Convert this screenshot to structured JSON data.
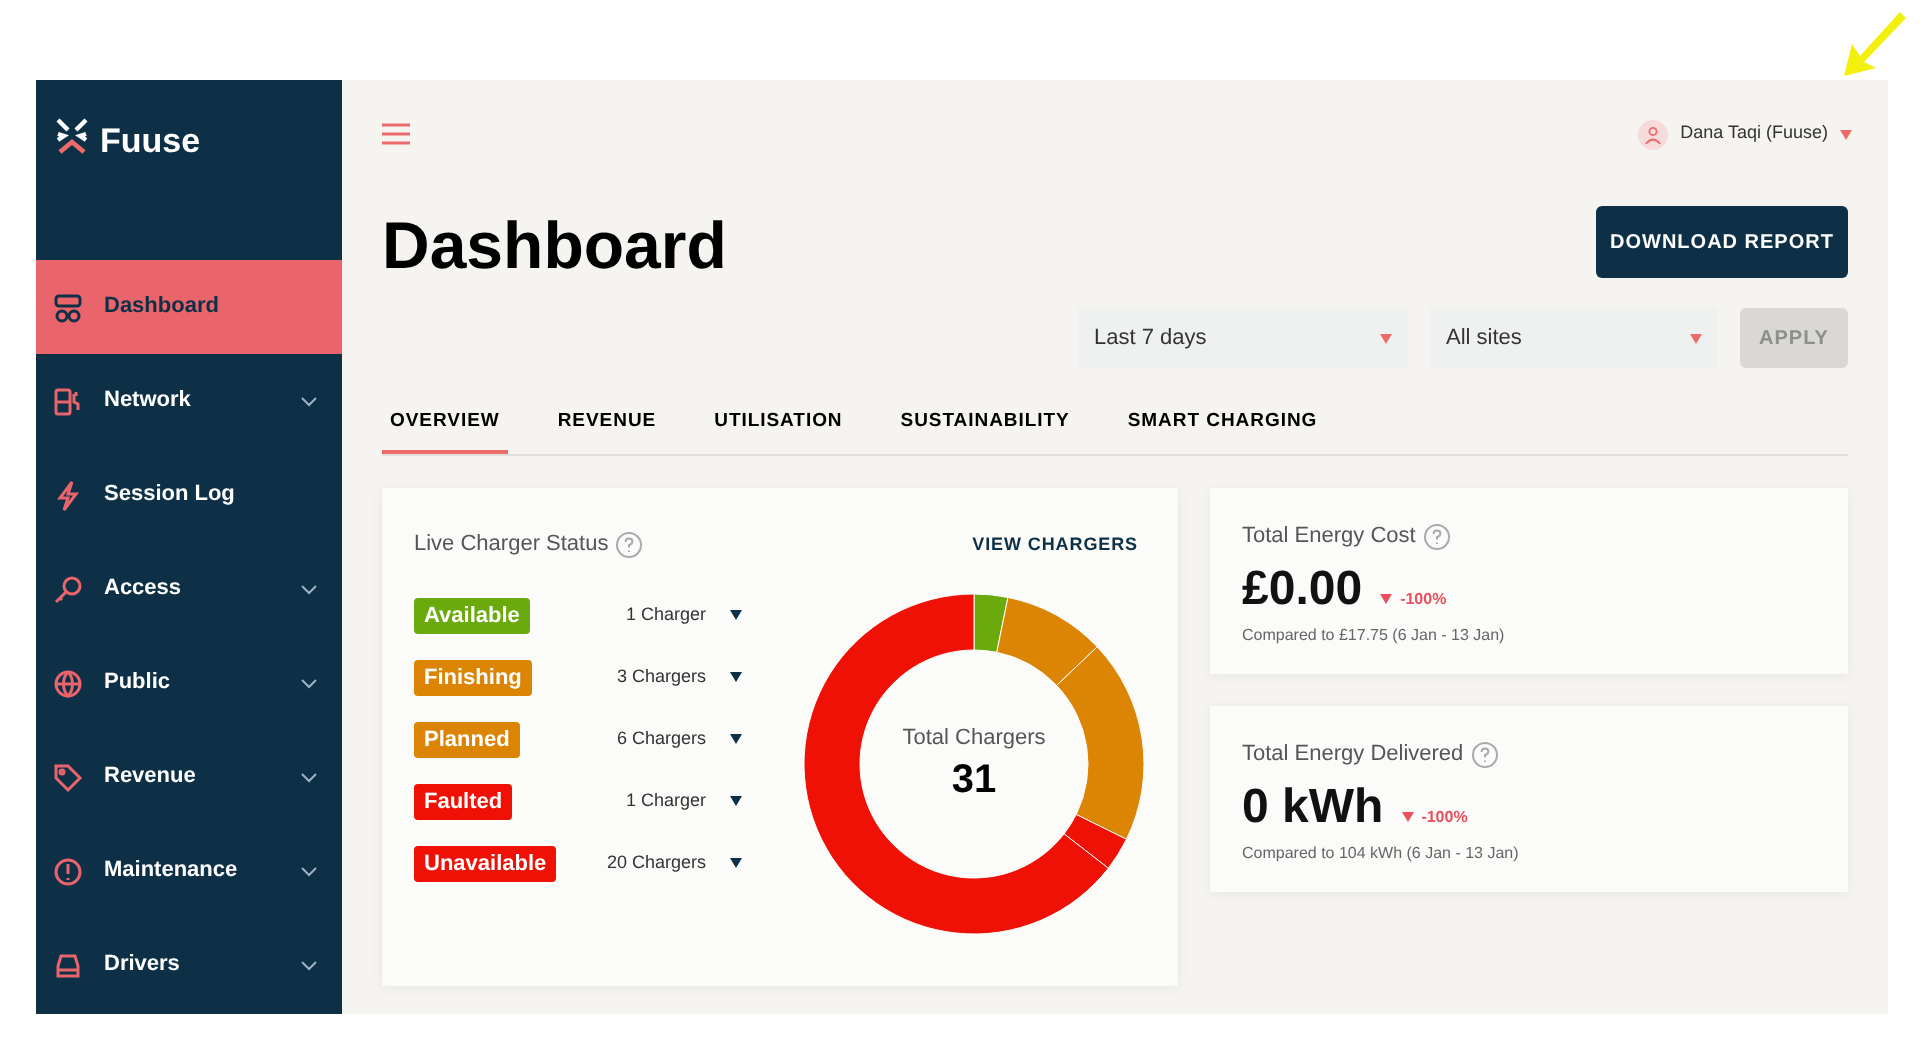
{
  "brand": {
    "name": "Fuuse"
  },
  "sidebar": {
    "items": [
      {
        "label": "Dashboard",
        "selected": true,
        "expandable": false
      },
      {
        "label": "Network",
        "selected": false,
        "expandable": true
      },
      {
        "label": "Session Log",
        "selected": false,
        "expandable": false
      },
      {
        "label": "Access",
        "selected": false,
        "expandable": true
      },
      {
        "label": "Public",
        "selected": false,
        "expandable": true
      },
      {
        "label": "Revenue",
        "selected": false,
        "expandable": true
      },
      {
        "label": "Maintenance",
        "selected": false,
        "expandable": true
      },
      {
        "label": "Drivers",
        "selected": false,
        "expandable": true
      }
    ]
  },
  "user": {
    "name": "Dana Taqi (Fuuse)"
  },
  "page_title": "Dashboard",
  "download_button": "DOWNLOAD REPORT",
  "filters": [
    {
      "value": "Last 7 days"
    },
    {
      "value": "All sites"
    }
  ],
  "apply_button": {
    "label": "APPLY",
    "disabled": true
  },
  "tabs": [
    {
      "label": "OVERVIEW",
      "selected": true
    },
    {
      "label": "REVENUE",
      "selected": false
    },
    {
      "label": "UTILISATION",
      "selected": false
    },
    {
      "label": "SUSTAINABILITY",
      "selected": false
    },
    {
      "label": "SMART CHARGING",
      "selected": false
    }
  ],
  "charger_status": {
    "title": "Live Charger Status",
    "link": "VIEW CHARGERS",
    "statuses": [
      {
        "count": "1 Charger",
        "color": "#6aaa0c"
      },
      {
        "count": "3 Chargers",
        "color": "#dc8505"
      },
      {
        "count": "6 Chargers",
        "color": "#dc8505"
      },
      {
        "count": "1 Charger",
        "color": "#ef1106"
      },
      {
        "count": "20 Chargers",
        "color": "#ef1106"
      }
    ],
    "center_label": "Total Chargers",
    "total": "31",
    "chart_data": {
      "type": "donut",
      "categories": [
        "Available",
        "Finishing",
        "Planned",
        "Faulted",
        "Unavailable"
      ],
      "values": [
        3.2,
        9.7,
        19.4,
        3.2,
        64.5
      ]
    }
  },
  "metrics": [
    {
      "title": "Total Energy Cost",
      "value": "£0.00",
      "decrease": true,
      "change": "-100%",
      "comparison": "Compared to £17.75 (6 Jan - 13 Jan)"
    },
    {
      "title": "Total Energy Delivered",
      "value": "0 kWh",
      "decrease": true,
      "change": "-100%",
      "comparison": "Compared to 104 kWh (6 Jan - 13 Jan)"
    }
  ]
}
